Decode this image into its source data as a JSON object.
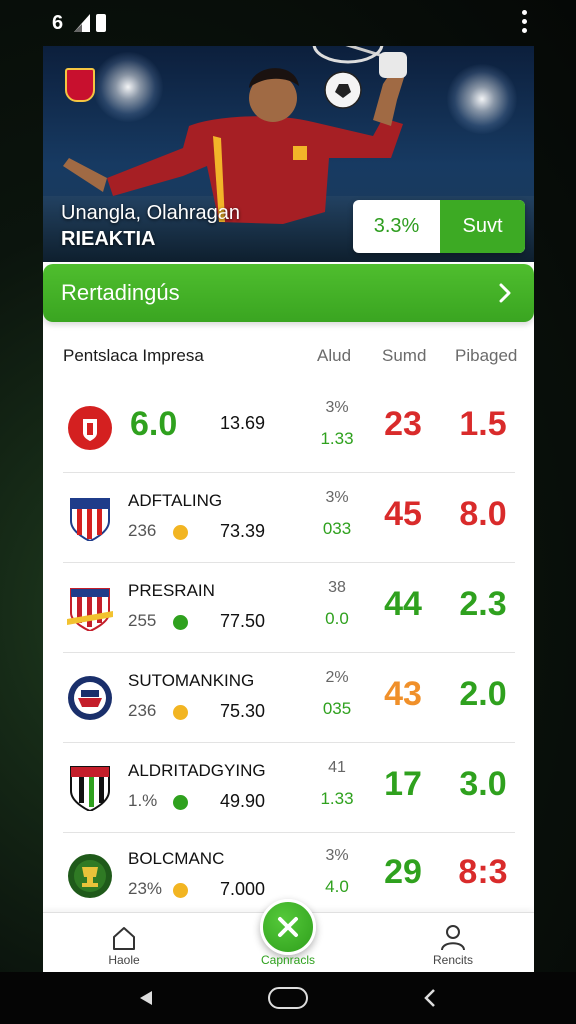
{
  "status_bar": {
    "time": "6"
  },
  "hero": {
    "title_line1": "Unangla, Olahragan",
    "title_line2": "RIEAKTIA",
    "percent": "3.3%",
    "action_label": "Suvt"
  },
  "banner": {
    "title": "Rertadingús"
  },
  "table": {
    "headers": {
      "name": "Pentslaca Impresa",
      "col_a": "Alud",
      "col_b": "Sumd",
      "col_c": "Pibaged"
    },
    "rows": [
      {
        "big_left": "6.0",
        "value": "13.69",
        "stat_top": "3%",
        "stat_bottom": "1.33",
        "big_a": "23",
        "big_b": "1.5",
        "color_a": "#d92b2b",
        "color_b": "#d92b2b"
      },
      {
        "name": "ADFTALING",
        "sub": "236",
        "dot": "#f2b522",
        "value": "73.39",
        "stat_top": "3%",
        "stat_bottom": "033",
        "big_a": "45",
        "big_b": "8.0",
        "color_a": "#d92b2b",
        "color_b": "#d92b2b"
      },
      {
        "name": "PRESRAIN",
        "sub": "255",
        "dot": "#2fa11e",
        "value": "77.50",
        "stat_top": "38",
        "stat_bottom": "0.0",
        "big_a": "44",
        "big_b": "2.3",
        "color_a": "#2fa11e",
        "color_b": "#2fa11e"
      },
      {
        "name": "SUTOMANKING",
        "sub": "236",
        "dot": "#f2b522",
        "value": "75.30",
        "stat_top": "2%",
        "stat_bottom": "035",
        "big_a": "43",
        "big_b": "2.0",
        "color_a": "#f0902a",
        "color_b": "#2fa11e"
      },
      {
        "name": "ALDRITADGYING",
        "sub": "1.%",
        "dot": "#2fa11e",
        "value": "49.90",
        "stat_top": "41",
        "stat_bottom": "1.33",
        "big_a": "17",
        "big_b": "3.0",
        "color_a": "#2fa11e",
        "color_b": "#2fa11e"
      },
      {
        "name": "BOLCMANC",
        "sub": "23%",
        "dot": "#f2b522",
        "value": "7.000",
        "stat_top": "3%",
        "stat_bottom": "4.0",
        "big_a": "29",
        "big_b": "8:3",
        "color_a": "#2fa11e",
        "color_b": "#d92b2b"
      }
    ]
  },
  "bottom_nav": {
    "home_label": "Haole",
    "center_label": "Capnracls",
    "profile_label": "Rencits"
  },
  "icons": [
    "signal-icon",
    "battery-icon",
    "more-vertical-icon",
    "club-logo",
    "chevron-right-icon",
    "home-icon",
    "close-icon",
    "profile-icon",
    "back-icon",
    "home-pill-icon",
    "recent-icon"
  ],
  "colors": {
    "brand_green": "#3daa24",
    "red": "#d92b2b",
    "orange": "#f0902a",
    "yellow_dot": "#f2b522"
  }
}
